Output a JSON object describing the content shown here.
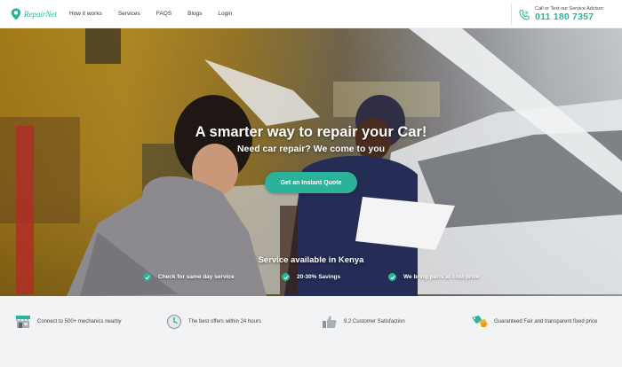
{
  "brand": {
    "name": "RepairNet",
    "accent": "#2bb39a"
  },
  "nav": {
    "items": [
      {
        "label": "How it works"
      },
      {
        "label": "Services"
      },
      {
        "label": "FAQS"
      },
      {
        "label": "Blogs"
      },
      {
        "label": "Login"
      }
    ]
  },
  "contact": {
    "label": "Call or Text our Service Advisor:",
    "phone": "011 180 7357",
    "icon": "phone-icon"
  },
  "hero": {
    "title": "A smarter way to repair your Car!",
    "subtitle": "Need car repair? We come to you",
    "cta_label": "Get an Instant Quote",
    "service_title": "Service available in Kenya",
    "features": [
      {
        "label": "Check for same day service"
      },
      {
        "label": "20-30% Savings"
      },
      {
        "label": "We bring parts at cost price"
      }
    ]
  },
  "strip": {
    "items": [
      {
        "label": "Connect to 500+ mechanics nearby",
        "icon": "shop-icon"
      },
      {
        "label": "The best offers within 24 hours",
        "icon": "clock-icon"
      },
      {
        "label": "9.2 Customer Satisfaction",
        "icon": "thumbs-up-icon"
      },
      {
        "label": "Guaranteed Fair and transparent fixed price",
        "icon": "price-tag-icon"
      }
    ]
  }
}
